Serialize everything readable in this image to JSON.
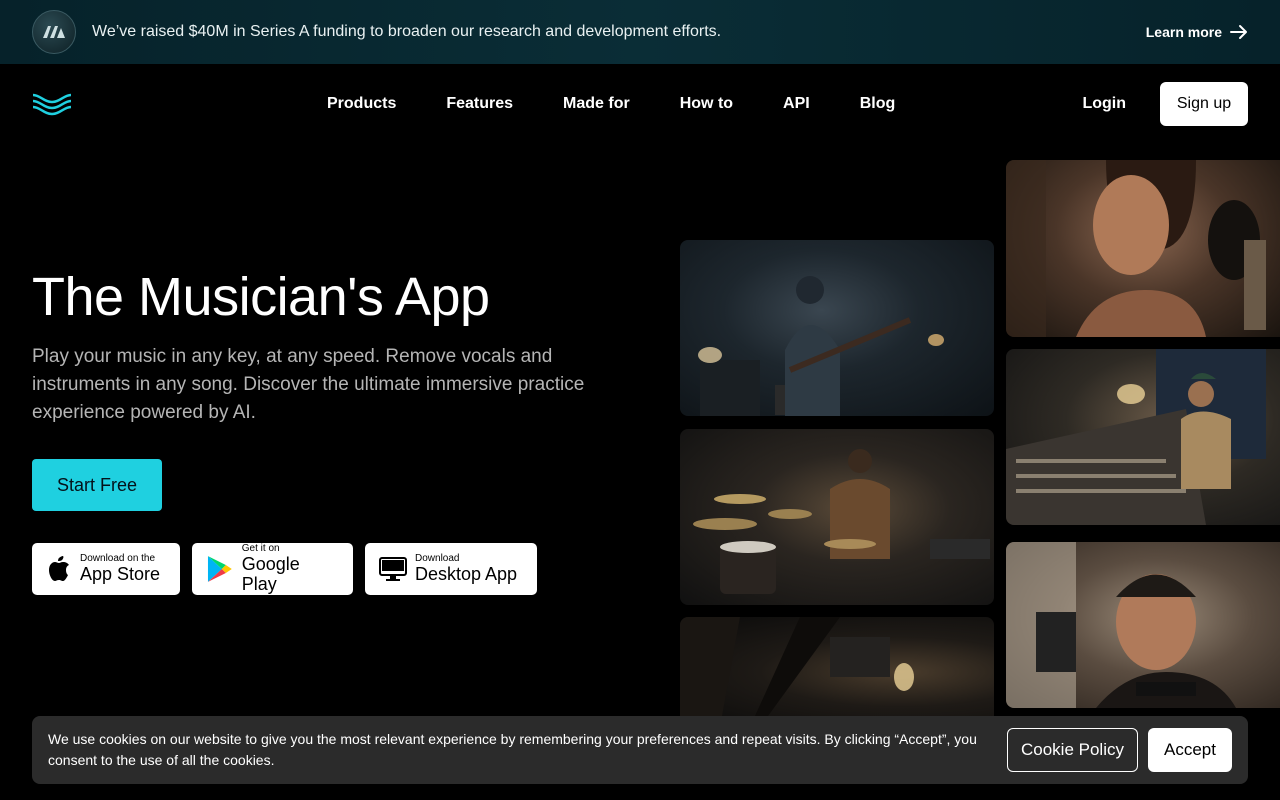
{
  "announcement": {
    "text": "We’ve raised $40M in Series A funding to broaden our research and development efforts.",
    "link_label": "Learn more"
  },
  "nav": {
    "links": [
      "Products",
      "Features",
      "Made for",
      "How to",
      "API",
      "Blog"
    ],
    "login_label": "Login",
    "signup_label": "Sign up"
  },
  "hero": {
    "title": "The Musician's App",
    "subtitle": "Play your music in any key, at any speed. Remove vocals and instruments in any song. Discover the ultimate immersive practice experience powered by AI.",
    "cta_label": "Start Free"
  },
  "stores": {
    "appstore": {
      "small": "Download on the",
      "big": "App Store"
    },
    "google": {
      "small": "Get it on",
      "big": "Google Play"
    },
    "desktop": {
      "small": "Download",
      "big": "Desktop App"
    }
  },
  "cookie": {
    "text": "We use cookies on our website to give you the most relevant experience by remembering your preferences and repeat visits. By clicking “Accept”, you consent to the use of all the cookies.",
    "policy_label": "Cookie Policy",
    "accept_label": "Accept"
  },
  "colors": {
    "accent": "#1fd0e0",
    "background": "#000000",
    "cookie_bg": "#2b2b2b"
  },
  "icons": [
    "moises-logo-icon",
    "brand-wave-icon",
    "arrow-right-icon",
    "apple-icon",
    "google-play-icon",
    "desktop-icon"
  ]
}
